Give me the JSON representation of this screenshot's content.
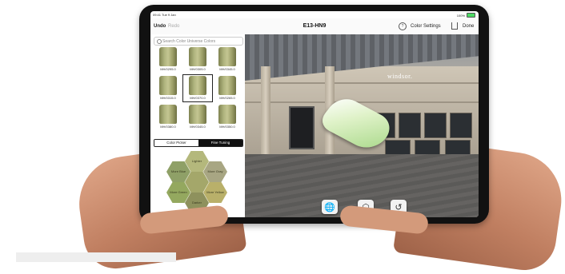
{
  "status": {
    "time": "09:41",
    "date": "Tue 9 Jan",
    "battery": "100%"
  },
  "nav": {
    "undo": "Undo",
    "redo": "Redo",
    "title": "E13-HN9",
    "settings": "Color Settings",
    "done": "Done",
    "help_icon": "?"
  },
  "search": {
    "placeholder": "Search Color Universe Colors"
  },
  "swatches": [
    {
      "label": "MH/0295.0"
    },
    {
      "label": "MH/0305.0"
    },
    {
      "label": "MH/0345.0"
    },
    {
      "label": "MH/0315.0"
    },
    {
      "label": "MH/0370.0"
    },
    {
      "label": "MH/0265.0"
    },
    {
      "label": "MH/0380.0"
    },
    {
      "label": "MH/0345.0"
    },
    {
      "label": "MH/0350.0"
    }
  ],
  "tabs": {
    "picker": "Color Picker",
    "fine": "Fine Tuning"
  },
  "hexes": {
    "lighter": "Lighter",
    "more_blue": "More Blue",
    "more_gray": "More Gray",
    "more_green": "More Green",
    "center": "",
    "more_yellow": "More Yellow",
    "darker": "Darker"
  },
  "scene": {
    "sign": "windsor."
  },
  "colors": {
    "accent_green": "#a9d98a",
    "hex_base": "#a4a76a"
  },
  "icons": {
    "globe": "globe-icon",
    "cube": "cube-icon",
    "reset": "rotate-icon"
  }
}
